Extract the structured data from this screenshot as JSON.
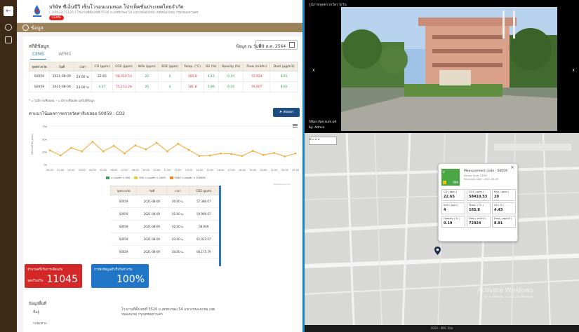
{
  "header": {
    "title": "บริษัท ซีเอ็นบีวี เซ็นโวรอนเมนทอล โปรเท็คชั่นประเทศไทยจำกัด",
    "subtitle": "[ 3/0022/71126 ] โรงงานที่ตั้งเลขที่ 5526 ถ.เพชรเกษม 54 แขวงหนองแขม เขตหนองแขม กรุงเทพมหานคร",
    "badge": "CEMS"
  },
  "subbar": {
    "label": "ข้อมูล"
  },
  "section_title": "สถิติข้อมูล",
  "date": {
    "label": "ข้อมูล ณ วันที่",
    "value": "09 ส.ค. 2564"
  },
  "tabs": [
    {
      "label": "CEMS"
    },
    {
      "label": "WPMS"
    }
  ],
  "table1": {
    "headers": [
      "จุดตรวจวัด",
      "วันที่",
      "เวลา",
      "CO (ppm)",
      "CO2 (ppm)",
      "NOx (ppm)",
      "SO2 (ppm)",
      "Temp. (°C)",
      "O2 (%)",
      "Opacity (%)",
      "Flow (m3/hr)",
      "Dust (µg/m3)"
    ],
    "rows": [
      [
        "S0059",
        "2021-08-09",
        "23:00 น.",
        "22.65",
        "58,410.53",
        "20",
        "4",
        "165.8",
        "4.43",
        "0.19",
        "72,924",
        "8.91"
      ],
      [
        "S0059",
        "2021-08-09",
        "23:00 น.",
        "4.37",
        "75,113.28",
        "20",
        "4",
        "181.8",
        "5.89",
        "0.10",
        "79,607",
        "8.93"
      ]
    ]
  },
  "note": "* = ไม่มีการเชื่อมต่อ, - = มีการเชื่อมต่อ แต่ไม่มีข้อมูล",
  "chart_title": "ค่าแนวโน้มผลการตรวจวัดค่าสิ่งปล่อย S0059 : CO2",
  "export_label": "ส่งออก",
  "chart_data": {
    "type": "line",
    "ylabel": "ปริมาณก๊าซ (ppm)",
    "yticks": [
      "75k",
      "50k",
      "25k",
      "0k"
    ],
    "ylim": [
      0,
      80000
    ],
    "x": [
      "00:00",
      "01:00",
      "02:00",
      "03:00",
      "04:00",
      "05:00",
      "06:00",
      "07:00",
      "08:00",
      "09:00",
      "10:00",
      "11:00",
      "12:00",
      "13:00",
      "14:00",
      "15:00",
      "16:00",
      "17:00",
      "18:00",
      "19:00",
      "20:00",
      "21:00",
      "22:00",
      "23:00"
    ],
    "series": [
      {
        "values": [
          28000,
          18000,
          33000,
          26000,
          45000,
          26000,
          37000,
          22000,
          38000,
          30000,
          43000,
          26000,
          41000,
          29000,
          17000,
          18000,
          22000,
          21000,
          17000,
          27000,
          19000,
          23000,
          16000,
          22000
        ],
        "color": "#f5a524"
      }
    ],
    "legend": [
      "< เกณฑ์ฯ < 500",
      "500 < เกณฑ์ฯ < 1000",
      "1000 < เกณฑ์ฯ < 100000"
    ],
    "legend_colors": [
      "#3aa655",
      "#e3d23a",
      "#f08a24"
    ],
    "credit": "Highcharts.com",
    "grid": true
  },
  "table2": {
    "headers": [
      "จุดตรวจวัด",
      "วันที่",
      "เวลา",
      "CO2 (ppm)"
    ],
    "rows": [
      [
        "S0059",
        "2021-08-09",
        "00:00 น.",
        "57,386.07"
      ],
      [
        "S0059",
        "2021-08-09",
        "01:00 น.",
        "59,996.67"
      ],
      [
        "S0059",
        "2021-08-09",
        "02:00 น.",
        "58,909"
      ],
      [
        "S0059",
        "2021-08-09",
        "03:00 น.",
        "61,021.67"
      ],
      [
        "S0059",
        "2021-08-09",
        "04:00 น.",
        "66,175.79"
      ]
    ]
  },
  "box1": {
    "label": "จำนวนครั้งในการเตือนภัย",
    "sub": "จุดเกินเกิน",
    "value": "11045"
  },
  "box2": {
    "label": "การส่งข้อมูลสำเร็จในช่วงวัน",
    "value": "100%"
  },
  "place": {
    "title": "ข้อมูลพื้นที่",
    "addr_label": "ที่อยู่",
    "addr": "โรงงานที่ตั้งเลขที่ 5526 ถ.เพชรเกษม 54 แขวงหนองแขม เขตหนองแขม กรุงเทพมหานคร",
    "l2": "ระยะทาง"
  },
  "photo": {
    "title": "รูปภาพจุดตรวจวัดรายวัน",
    "url": "https://picsum.ph",
    "by": "by: Admin"
  },
  "popup": {
    "aqi_label": "d",
    "aqi_num": "999",
    "title": "Measurement code : S0059",
    "sensor": "Sensor type: CEMS",
    "recorded": "Recorded date : 2021-08-09",
    "cells": [
      {
        "k": "CO ( ppm )",
        "v": "22.65"
      },
      {
        "k": "CO2 ( ppm )",
        "v": "58410.53"
      },
      {
        "k": "NOx ( ppm )",
        "v": "20"
      },
      {
        "k": "SO2 ( ppm )",
        "v": "4"
      },
      {
        "k": "Temp. ( °C )",
        "v": "165.8"
      },
      {
        "k": "O2 ( % )",
        "v": "4.43"
      },
      {
        "k": "Opacity ( % )",
        "v": "0.19"
      },
      {
        "k": "Flow ( m3/hr )",
        "v": "72924"
      },
      {
        "k": "Dust ( µg/m3 )",
        "v": "8.91"
      }
    ]
  },
  "map": {
    "watermark": "Activate Windows",
    "watermark_sub": "Go to Settings to activate Windows.",
    "controls": "ห้าม ⊕ ⊕"
  },
  "footer": "2020 · EMC Site"
}
